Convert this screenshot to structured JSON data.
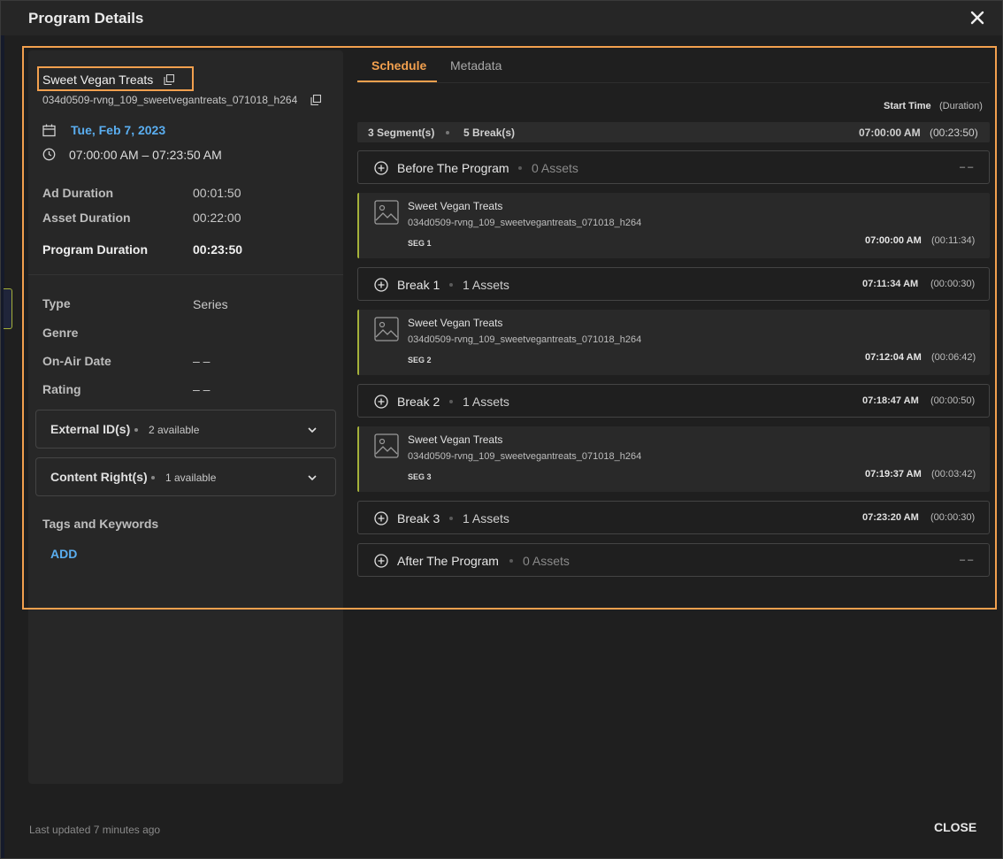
{
  "dialog": {
    "title": "Program Details"
  },
  "program": {
    "title": "Sweet Vegan Treats",
    "id": "034d0509-rvng_109_sweetvegantreats_071018_h264",
    "date": "Tue, Feb 7, 2023",
    "time_range": "07:00:00 AM – 07:23:50 AM"
  },
  "durations": [
    {
      "label": "Ad Duration",
      "value": "00:01:50"
    },
    {
      "label": "Asset Duration",
      "value": "00:22:00"
    },
    {
      "label": "Program Duration",
      "value": "00:23:50"
    }
  ],
  "details": [
    {
      "label": "Type",
      "value": "Series"
    },
    {
      "label": "Genre",
      "value": ""
    },
    {
      "label": "On-Air Date",
      "value": "– –"
    },
    {
      "label": "Rating",
      "value": "– –"
    }
  ],
  "expanders": [
    {
      "label": "External ID(s)",
      "count": "2 available"
    },
    {
      "label": "Content Right(s)",
      "count": "1 available"
    }
  ],
  "tags": {
    "label": "Tags and Keywords",
    "add_label": "ADD"
  },
  "tabs": [
    {
      "label": "Schedule",
      "active": true
    },
    {
      "label": "Metadata",
      "active": false
    }
  ],
  "schedule": {
    "start_time_label": "Start Time",
    "duration_label": "(Duration)",
    "summary": {
      "segments": "3 Segment(s)",
      "breaks": "5 Break(s)",
      "start": "07:00:00 AM",
      "duration": "(00:23:50)"
    },
    "before": {
      "name": "Before The Program",
      "assets": "0 Assets",
      "time": "– –"
    },
    "segments": [
      {
        "title": "Sweet Vegan Treats",
        "id": "034d0509-rvng_109_sweetvegantreats_071018_h264",
        "label": "SEG 1",
        "start": "07:00:00 AM",
        "duration": "(00:11:34)"
      },
      {
        "title": "Sweet Vegan Treats",
        "id": "034d0509-rvng_109_sweetvegantreats_071018_h264",
        "label": "SEG 2",
        "start": "07:12:04 AM",
        "duration": "(00:06:42)"
      },
      {
        "title": "Sweet Vegan Treats",
        "id": "034d0509-rvng_109_sweetvegantreats_071018_h264",
        "label": "SEG 3",
        "start": "07:19:37 AM",
        "duration": "(00:03:42)"
      }
    ],
    "breaks": [
      {
        "name": "Break 1",
        "assets": "1 Assets",
        "start": "07:11:34 AM",
        "duration": "(00:00:30)"
      },
      {
        "name": "Break 2",
        "assets": "1 Assets",
        "start": "07:18:47 AM",
        "duration": "(00:00:50)"
      },
      {
        "name": "Break 3",
        "assets": "1 Assets",
        "start": "07:23:20 AM",
        "duration": "(00:00:30)"
      }
    ],
    "after": {
      "name": "After The Program",
      "assets": "0 Assets",
      "time": "– –"
    }
  },
  "footer": {
    "last_updated": "Last updated 7 minutes ago",
    "close_label": "CLOSE"
  },
  "colors": {
    "accent": "#f2a04e",
    "link": "#5aaef0",
    "segment_marker": "#a5b13a"
  }
}
